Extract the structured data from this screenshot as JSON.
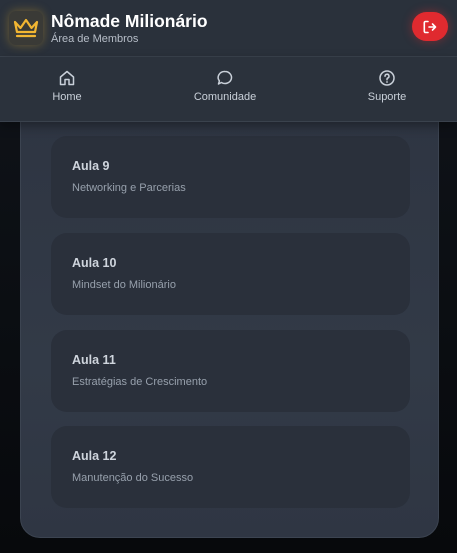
{
  "header": {
    "title": "Nômade Milionário",
    "subtitle": "Área de Membros",
    "logo_icon": "crown-icon",
    "logout_icon": "logout-icon",
    "accent_gold": "#f2b632",
    "logout_color": "#e02a2f"
  },
  "nav": {
    "items": [
      {
        "label": "Home",
        "icon": "home-icon"
      },
      {
        "label": "Comunidade",
        "icon": "chat-bubble-icon"
      },
      {
        "label": "Suporte",
        "icon": "help-circle-icon"
      }
    ]
  },
  "lessons": [
    {
      "title": "Aula 9",
      "subtitle": "Networking e Parcerias"
    },
    {
      "title": "Aula 10",
      "subtitle": "Mindset do Milionário"
    },
    {
      "title": "Aula 11",
      "subtitle": "Estratégias de Crescimento"
    },
    {
      "title": "Aula 12",
      "subtitle": "Manutenção do Sucesso"
    }
  ]
}
